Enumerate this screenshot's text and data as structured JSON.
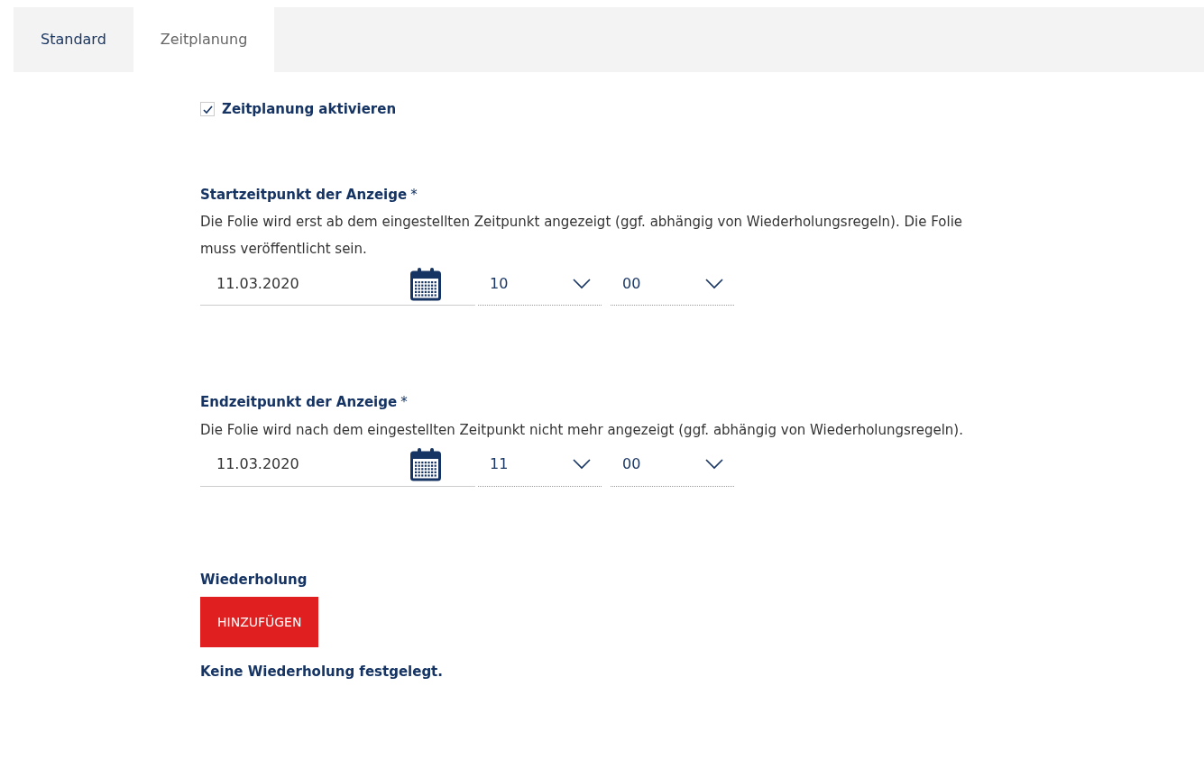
{
  "tabs": [
    {
      "label": "Standard",
      "selected": false
    },
    {
      "label": "Zeitplanung",
      "selected": true
    }
  ],
  "enable": {
    "label": "Zeitplanung aktivieren",
    "checked": true
  },
  "sections": [
    {
      "heading": "Startzeitpunkt der Anzeige",
      "required_mark": "*",
      "description": "Die Folie wird erst ab dem eingestellten Zeitpunkt angezeigt (ggf. abhängig von Wiederholungsregeln). Die Folie muss veröffentlicht sein.",
      "date": "11.03.2020",
      "hour": "10",
      "minute": "00"
    },
    {
      "heading": "Endzeitpunkt der Anzeige",
      "required_mark": "*",
      "description": "Die Folie wird nach dem eingestellten Zeitpunkt nicht mehr angezeigt (ggf. abhängig von Wiederholungsregeln).",
      "date": "11.03.2020",
      "hour": "11",
      "minute": "00"
    }
  ],
  "repeat": {
    "heading": "Wiederholung",
    "button": "HINZUFÜGEN",
    "status": "Keine Wiederholung festgelegt."
  }
}
